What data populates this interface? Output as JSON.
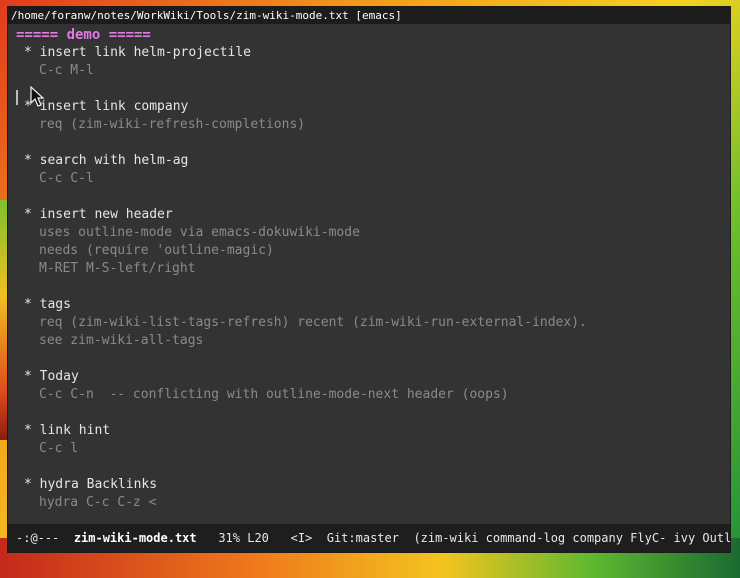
{
  "window": {
    "title": "/home/foranw/notes/WorkWiki/Tools/zim-wiki-mode.txt [emacs]"
  },
  "buffer": {
    "heading": "===== demo =====",
    "sections": [
      {
        "title": "* insert link helm-projectile",
        "lines": [
          "C-c M-l"
        ]
      },
      {
        "title": "* insert link company",
        "lines": [
          "req (zim-wiki-refresh-completions)"
        ]
      },
      {
        "title": "* search with helm-ag",
        "lines": [
          "C-c C-l"
        ]
      },
      {
        "title": "* insert new header",
        "lines": [
          "uses outline-mode via emacs-dokuwiki-mode",
          "needs (require 'outline-magic)",
          "M-RET M-S-left/right"
        ]
      },
      {
        "title": "* tags",
        "lines": [
          "req (zim-wiki-list-tags-refresh) recent (zim-wiki-run-external-index).",
          "see zim-wiki-all-tags"
        ]
      },
      {
        "title": "* Today",
        "lines": [
          "C-c C-n  -- conflicting with outline-mode-next header (oops)"
        ]
      },
      {
        "title": "* link hint",
        "lines": [
          "C-c l"
        ]
      },
      {
        "title": "* hydra Backlinks",
        "lines": [
          "hydra C-c C-z <"
        ]
      }
    ]
  },
  "modeline": {
    "state": "-:@---",
    "buffer_name": "zim-wiki-mode.txt",
    "position": "31% L20",
    "evil_state": "<I>",
    "vcs": "Git:master",
    "modes": "(zim-wiki command-log company FlyC- ivy Outlkj"
  },
  "colors": {
    "background": "#333333",
    "heading": "#e07be0",
    "text_bright": "#e6e6e6",
    "text_dim": "#8a8a8a",
    "modeline_bg": "#1e1e1e"
  }
}
